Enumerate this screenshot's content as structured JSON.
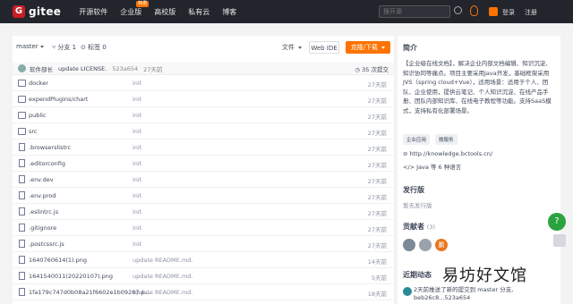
{
  "topnav": {
    "logo_text": "gitee",
    "links": [
      "开源软件",
      "企业版",
      "高校版",
      "私有云",
      "博客"
    ],
    "badge": "特惠",
    "search_placeholder": "搜开源",
    "login": "登录",
    "register": "注册"
  },
  "toolbar": {
    "branch": "master",
    "branches": "分支 1",
    "tags": "标签 0",
    "file_button": "文件",
    "webide_button": "Web IDE",
    "clone_button": "克隆/下载"
  },
  "commit": {
    "author": "软件部长",
    "message": "update LICENSE.",
    "hash": "523a654",
    "time": "27天前",
    "count": "35 次提交"
  },
  "files": [
    {
      "name": "docker",
      "type": "folder",
      "commit": "init",
      "time": "27天前"
    },
    {
      "name": "expendPlugins/chart",
      "type": "folder",
      "commit": "init",
      "time": "27天前"
    },
    {
      "name": "public",
      "type": "folder",
      "commit": "init",
      "time": "27天前"
    },
    {
      "name": "src",
      "type": "folder",
      "commit": "init",
      "time": "27天前"
    },
    {
      "name": ".browserslistrc",
      "type": "file",
      "commit": "init",
      "time": "27天前"
    },
    {
      "name": ".editorconfig",
      "type": "file",
      "commit": "init",
      "time": "27天前"
    },
    {
      "name": ".env.dev",
      "type": "file",
      "commit": "init",
      "time": "27天前"
    },
    {
      "name": ".env.prod",
      "type": "file",
      "commit": "init",
      "time": "27天前"
    },
    {
      "name": ".eslintrc.js",
      "type": "file",
      "commit": "init",
      "time": "27天前"
    },
    {
      "name": ".gitignore",
      "type": "file",
      "commit": "init",
      "time": "27天前"
    },
    {
      "name": ".postcssrc.js",
      "type": "file",
      "commit": "init",
      "time": "27天前"
    },
    {
      "name": "1640760614(1).png",
      "type": "file",
      "commit": "update README.md.",
      "time": "14天前"
    },
    {
      "name": "1641540011(20220107).png",
      "type": "file",
      "commit": "update README.md.",
      "time": "5天前"
    },
    {
      "name": "1fa179c747d0b08a21f6602e1b09287.p...",
      "type": "file",
      "commit": "update README.md.",
      "time": "18天前"
    }
  ],
  "sidebar": {
    "intro_title": "简介",
    "description": "【企业级在线文档】，解决企业内部文档编辑、知识沉淀、知识协同等痛点。项目主要采用Java开发，基础框架采用JVS（spring cloud+Vue），适用场景：适用于个人、团队、企业使用，提供云笔记、个人知识沉淀、在线产品手册、团队内部知识库、在线电子教程等功能。支持SaaS模式，支持私有化部署场景。",
    "tags": [
      "企业应用",
      "微服务"
    ],
    "link": "http://knowledge.bctools.cn/",
    "language": "Java 等 6 种语言",
    "release_title": "发行版",
    "release_none": "暂无发行版",
    "contributors_title": "贡献者",
    "contributors_count": "(3)",
    "contributor_avatar_text": "鹏",
    "activity_title": "近期动态",
    "activity_text": "2天前推送了新的提交到 master 分支, beb26c8...523a654"
  },
  "watermark": "易坊好文馆",
  "colors": {
    "accent": "#fe7300",
    "nav_bg": "#22252c",
    "brand": "#c71d23"
  }
}
